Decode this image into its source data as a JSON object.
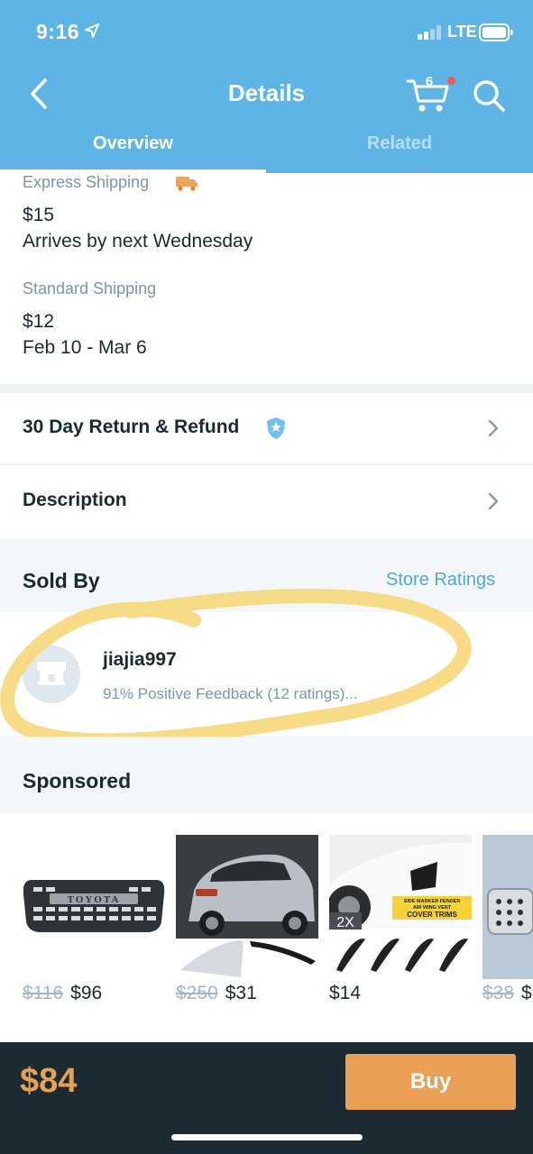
{
  "status_bar": {
    "time": "9:16",
    "network": "LTE"
  },
  "header": {
    "title": "Details",
    "cart_count": "6"
  },
  "tabs": [
    {
      "label": "Overview",
      "active": true
    },
    {
      "label": "Related",
      "active": false
    }
  ],
  "shipping": {
    "express": {
      "label": "Express Shipping",
      "price": "$15",
      "arrival": "Arrives by next Wednesday"
    },
    "standard": {
      "label": "Standard Shipping",
      "price": "$12",
      "arrival": "Feb 10 - Mar 6"
    }
  },
  "rows": {
    "return_refund": "30 Day Return & Refund",
    "description": "Description"
  },
  "sold_by": {
    "label": "Sold By",
    "store_ratings": "Store Ratings",
    "seller_name": "jiajia997",
    "feedback": "91% Positive Feedback (12 ratings)..."
  },
  "sponsored": {
    "label": "Sponsored",
    "items": [
      {
        "old_price": "$116",
        "price": "$96",
        "image": "black truck grille with TOYOTA lettering"
      },
      {
        "old_price": "$250",
        "price": "$31",
        "image": "silver SUV rear view with chrome trim"
      },
      {
        "old_price": "",
        "price": "$14",
        "image": "white car side fender vent trims",
        "overlay_2x": "2X",
        "overlay_line1": "SIDE MARKER FENDER",
        "overlay_line2": "AIR WING VENT",
        "overlay_line3": "COVER TRIMS"
      },
      {
        "old_price": "$38",
        "price": "$",
        "image": "car pedal pads"
      }
    ]
  },
  "footer": {
    "total": "$84",
    "buy_label": "Buy"
  },
  "colors": {
    "header": "#5fb4e6",
    "accent_orange": "#e9a055",
    "link_blue": "#4fa8d8",
    "footer": "#1b2a33",
    "highlight_marker": "#f6d77a"
  }
}
